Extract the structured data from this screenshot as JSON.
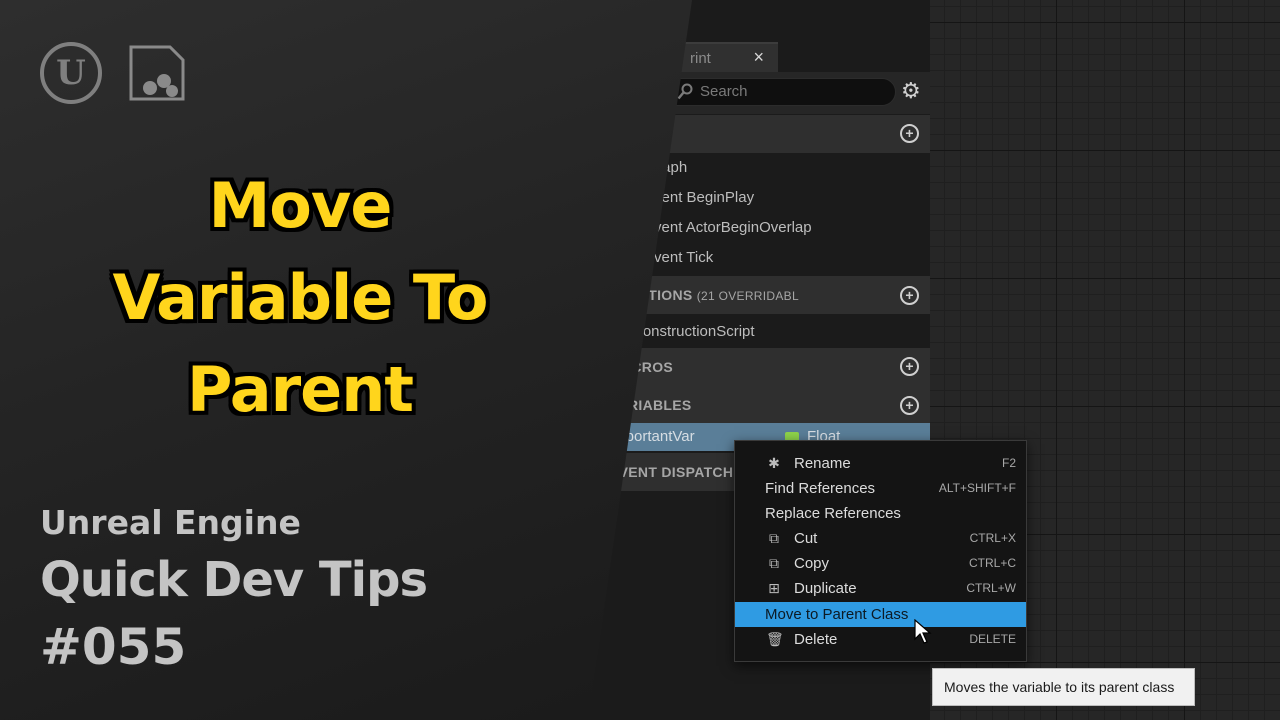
{
  "tab": {
    "label": "rint",
    "close": "×"
  },
  "search": {
    "placeholder": "Search"
  },
  "sections": {
    "functions_title": "UNCTIONS",
    "functions_note": "(21 OVERRIDABL",
    "macros_title": "MACROS",
    "variables_title": "VARIABLES",
    "dispatchers_title": "EVENT DISPATCHI"
  },
  "graph_items": [
    "ntGraph",
    "Event BeginPlay",
    "Event ActorBeginOverlap",
    "Event Tick"
  ],
  "function_items": [
    "ConstructionScript"
  ],
  "variable": {
    "name": "ImportantVar",
    "type": "Float"
  },
  "context_menu": [
    {
      "label": "Rename",
      "shortcut": "F2",
      "icon": "rename-icon"
    },
    {
      "label": "Find References",
      "shortcut": "ALT+SHIFT+F",
      "icon": ""
    },
    {
      "label": "Replace References",
      "shortcut": "",
      "icon": ""
    },
    {
      "label": "Cut",
      "shortcut": "CTRL+X",
      "icon": "cut-icon"
    },
    {
      "label": "Copy",
      "shortcut": "CTRL+C",
      "icon": "copy-icon"
    },
    {
      "label": "Duplicate",
      "shortcut": "CTRL+W",
      "icon": "duplicate-icon"
    },
    {
      "label": "Move to Parent Class",
      "shortcut": "",
      "icon": "",
      "highlighted": true
    },
    {
      "label": "Delete",
      "shortcut": "DELETE",
      "icon": "delete-icon"
    }
  ],
  "tooltip": "Moves the variable to its parent class",
  "title_card": {
    "headline": [
      "Move",
      "Variable To",
      "Parent"
    ],
    "subtitle_1": "Unreal Engine",
    "subtitle_2": "Quick Dev Tips",
    "subtitle_3": "#055"
  },
  "colors": {
    "headline": "#ffd51c",
    "highlight": "#2f9be3",
    "variable_row": "#5a7e98",
    "float_pin": "#8ed34a"
  }
}
